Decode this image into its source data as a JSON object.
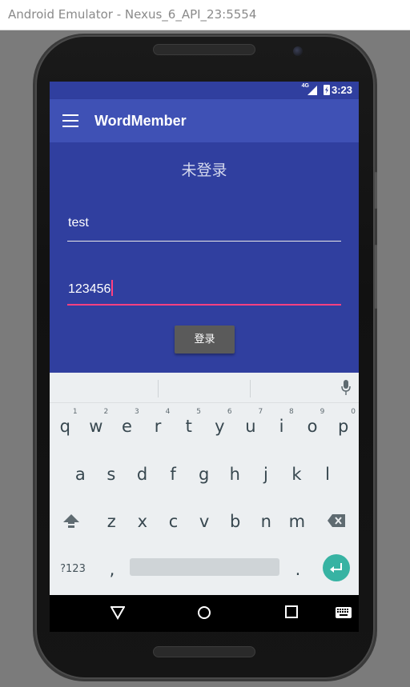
{
  "window": {
    "title": "Android Emulator - Nexus_6_API_23:5554"
  },
  "statusbar": {
    "network": "4G",
    "time": "3:23"
  },
  "appbar": {
    "title": "WordMember",
    "menu_icon": "hamburger-menu-icon"
  },
  "main": {
    "login_status": "未登录",
    "username_value": "test",
    "password_value": "123456",
    "login_button": "登录"
  },
  "keyboard": {
    "row1": [
      {
        "key": "q",
        "hint": "1"
      },
      {
        "key": "w",
        "hint": "2"
      },
      {
        "key": "e",
        "hint": "3"
      },
      {
        "key": "r",
        "hint": "4"
      },
      {
        "key": "t",
        "hint": "5"
      },
      {
        "key": "y",
        "hint": "6"
      },
      {
        "key": "u",
        "hint": "7"
      },
      {
        "key": "i",
        "hint": "8"
      },
      {
        "key": "o",
        "hint": "9"
      },
      {
        "key": "p",
        "hint": "0"
      }
    ],
    "row2": [
      "a",
      "s",
      "d",
      "f",
      "g",
      "h",
      "j",
      "k",
      "l"
    ],
    "row3": [
      "z",
      "x",
      "c",
      "v",
      "b",
      "n",
      "m"
    ],
    "symbols_key": "?123",
    "comma_key": ",",
    "period_key": ".",
    "icons": [
      "shift-icon",
      "backspace-icon",
      "microphone-icon",
      "enter-icon"
    ]
  },
  "navbar": {
    "icons": [
      "back-icon",
      "home-icon",
      "recents-icon",
      "keyboard-switch-icon"
    ]
  },
  "colors": {
    "primary": "#3f51b5",
    "primary_dark": "#303f9f",
    "accent": "#ff4081",
    "enter_key": "#37b3a3"
  }
}
